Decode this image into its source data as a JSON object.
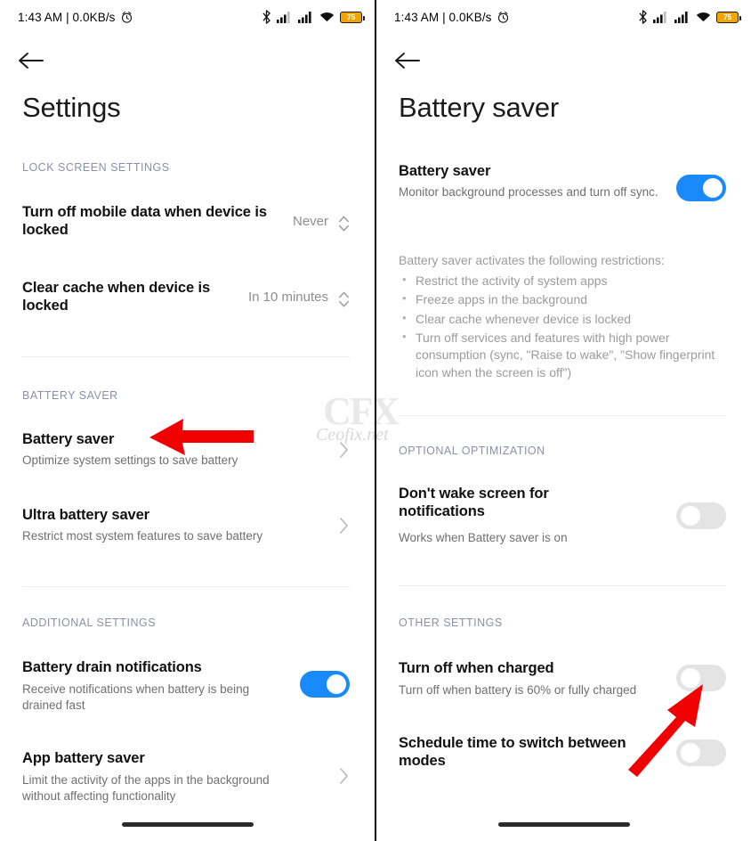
{
  "status_bar": {
    "time_and_speed": "1:43 AM | 0.0KB/s",
    "alarm_icon": "alarm-icon",
    "bluetooth_icon": "bluetooth-icon",
    "signal_icon_1": "signal-bars-icon",
    "signal_icon_2": "signal-bars-icon",
    "wifi_icon": "wifi-icon",
    "battery_level": "75",
    "battery_color": "#f0a500"
  },
  "watermark": {
    "logo": "CFX",
    "text": "Ceofix.net"
  },
  "colors": {
    "toggle_on": "#1a89fa",
    "toggle_off": "#e4e4e4",
    "section_header": "#8b90a8",
    "annotation_arrow": "#f00000"
  },
  "left_screen": {
    "back_icon": "back-arrow-icon",
    "title": "Settings",
    "sections": [
      {
        "header": "LOCK SCREEN SETTINGS",
        "rows": [
          {
            "title": "Turn off mobile data when device is locked",
            "subtitle": "",
            "value": "Never",
            "control": "stepper"
          },
          {
            "title": "Clear cache when device is locked",
            "subtitle": "",
            "value": "In 10 minutes",
            "control": "stepper"
          }
        ]
      },
      {
        "header": "BATTERY SAVER",
        "rows": [
          {
            "title": "Battery saver",
            "subtitle": "Optimize system settings to save battery",
            "value": "",
            "control": "chevron"
          },
          {
            "title": "Ultra battery saver",
            "subtitle": "Restrict most system features to save battery",
            "value": "",
            "control": "chevron"
          }
        ]
      },
      {
        "header": "ADDITIONAL SETTINGS",
        "rows": [
          {
            "title": "Battery drain notifications",
            "subtitle": "Receive notifications when battery is being drained fast",
            "value": "",
            "control": "toggle-on"
          },
          {
            "title": "App battery saver",
            "subtitle": "Limit the activity of the apps in the background without affecting functionality",
            "value": "",
            "control": "chevron"
          }
        ]
      }
    ]
  },
  "right_screen": {
    "back_icon": "back-arrow-icon",
    "title": "Battery saver",
    "main_row": {
      "title": "Battery saver",
      "subtitle": "Monitor background processes and turn off sync.",
      "control": "toggle-on"
    },
    "restrictions": {
      "intro": "Battery saver activates the following restrictions:",
      "items": [
        "Restrict the activity of system apps",
        "Freeze apps in the background",
        "Clear cache whenever device is locked",
        "Turn off services and features with high power consumption (sync, \"Raise to wake\", \"Show fingerprint icon when the screen is off\")"
      ]
    },
    "sections": [
      {
        "header": "OPTIONAL OPTIMIZATION",
        "rows": [
          {
            "title": "Don't wake screen for notifications",
            "subtitle": "Works when Battery saver is on",
            "control": "toggle-off"
          }
        ]
      },
      {
        "header": "OTHER SETTINGS",
        "rows": [
          {
            "title": "Turn off when charged",
            "subtitle": "Turn off when battery is 60% or fully charged",
            "control": "toggle-off"
          },
          {
            "title": "Schedule time to switch between modes",
            "subtitle": "",
            "control": "toggle-off"
          }
        ]
      }
    ]
  }
}
